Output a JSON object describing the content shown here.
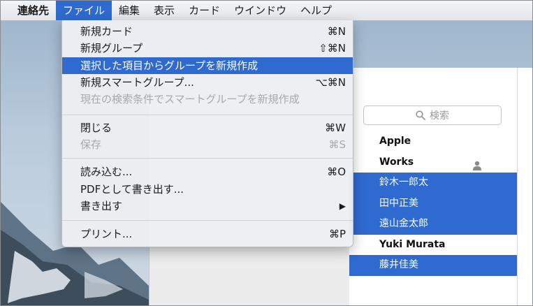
{
  "menubar": {
    "app": "連絡先",
    "items": [
      "ファイル",
      "編集",
      "表示",
      "カード",
      "ウインドウ",
      "ヘルプ"
    ]
  },
  "file_menu": {
    "items": [
      {
        "label": "新規カード",
        "shortcut": "⌘N",
        "state": "enabled"
      },
      {
        "label": "新規グループ",
        "shortcut": "⇧⌘N",
        "state": "enabled"
      },
      {
        "label": "選択した項目からグループを新規作成",
        "shortcut": "",
        "state": "highlighted"
      },
      {
        "label": "新規スマートグループ...",
        "shortcut": "⌥⌘N",
        "state": "enabled"
      },
      {
        "label": "現在の検索条件でスマートグループを新規作成",
        "shortcut": "",
        "state": "disabled"
      },
      {
        "label": "閉じる",
        "shortcut": "⌘W",
        "state": "enabled"
      },
      {
        "label": "保存",
        "shortcut": "⌘S",
        "state": "disabled"
      },
      {
        "label": "読み込む...",
        "shortcut": "⌘O",
        "state": "enabled"
      },
      {
        "label": "PDFとして書き出す...",
        "shortcut": "",
        "state": "enabled"
      },
      {
        "label": "書き出す",
        "shortcut": "▶",
        "state": "enabled"
      },
      {
        "label": "プリント...",
        "shortcut": "⌘P",
        "state": "enabled"
      }
    ]
  },
  "contacts": {
    "search_placeholder": "検索",
    "rows": [
      {
        "name": "Apple",
        "kind": "company",
        "selected": false
      },
      {
        "name": "Works",
        "kind": "me",
        "selected": false
      },
      {
        "name": "鈴木一郎太",
        "kind": "person",
        "selected": true
      },
      {
        "name": "田中正美",
        "kind": "person",
        "selected": true
      },
      {
        "name": "遠山金太郎",
        "kind": "person",
        "selected": true
      },
      {
        "name": "Yuki Murata",
        "kind": "company",
        "selected": false
      },
      {
        "name": "藤井佳美",
        "kind": "person",
        "selected": true
      }
    ]
  },
  "colors": {
    "selection": "#2f6ad0",
    "menu_bg": "#eceef2",
    "disabled_text": "#a6a9ae"
  },
  "icons": {
    "search": "magnifier-icon",
    "me_card": "person-icon"
  }
}
